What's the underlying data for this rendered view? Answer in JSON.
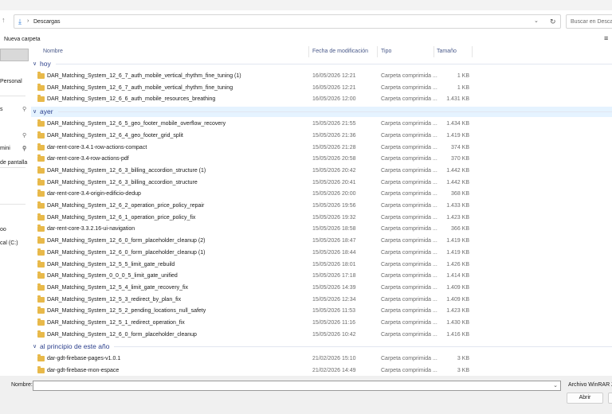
{
  "address": {
    "folder": "Descargas"
  },
  "search": {
    "placeholder": "Buscar en Descargas"
  },
  "toolbar": {
    "new_folder": "Nueva carpeta"
  },
  "sidebar": {
    "items": [
      {
        "label": "Personal",
        "pinned": false
      },
      {
        "label": "s",
        "pinned": true
      },
      {
        "label": "",
        "pinned": true
      },
      {
        "label": "",
        "pinned": true
      },
      {
        "label": "mini",
        "pinned": true
      },
      {
        "label": "de pantalla",
        "pinned": false
      },
      {
        "label": "",
        "pinned": false
      },
      {
        "label": "oo",
        "pinned": false
      },
      {
        "label": "cal (C:)",
        "pinned": false
      }
    ]
  },
  "columns": {
    "name": "Nombre",
    "date": "Fecha de modificación",
    "type": "Tipo",
    "size": "Tamaño"
  },
  "groups": [
    {
      "label": "hoy",
      "selected": false,
      "rows": [
        {
          "name": "DAR_Matching_System_12_6_7_auth_mobile_vertical_rhythm_fine_tuning (1)",
          "date": "16/05/2026 12:21",
          "type": "Carpeta comprimida ...",
          "size": "1 KB"
        },
        {
          "name": "DAR_Matching_System_12_6_7_auth_mobile_vertical_rhythm_fine_tuning",
          "date": "16/05/2026 12:21",
          "type": "Carpeta comprimida ...",
          "size": "1 KB"
        },
        {
          "name": "DAR_Matching_System_12_6_6_auth_mobile_resources_breathing",
          "date": "16/05/2026 12:00",
          "type": "Carpeta comprimida ...",
          "size": "1.431 KB"
        }
      ]
    },
    {
      "label": "ayer",
      "selected": true,
      "rows": [
        {
          "name": "DAR_Matching_System_12_6_5_geo_footer_mobile_overflow_recovery",
          "date": "15/05/2026 21:55",
          "type": "Carpeta comprimida ...",
          "size": "1.434 KB"
        },
        {
          "name": "DAR_Matching_System_12_6_4_geo_footer_grid_split",
          "date": "15/05/2026 21:36",
          "type": "Carpeta comprimida ...",
          "size": "1.419 KB"
        },
        {
          "name": "dar-rent-core-3.4.1-row-actions-compact",
          "date": "15/05/2026 21:28",
          "type": "Carpeta comprimida ...",
          "size": "374 KB"
        },
        {
          "name": "dar-rent-core-3.4-row-actions-pdf",
          "date": "15/05/2026 20:58",
          "type": "Carpeta comprimida ...",
          "size": "370 KB"
        },
        {
          "name": "DAR_Matching_System_12_6_3_billing_accordion_structure (1)",
          "date": "15/05/2026 20:42",
          "type": "Carpeta comprimida ...",
          "size": "1.442 KB"
        },
        {
          "name": "DAR_Matching_System_12_6_3_billing_accordion_structure",
          "date": "15/05/2026 20:41",
          "type": "Carpeta comprimida ...",
          "size": "1.442 KB"
        },
        {
          "name": "dar-rent-core-3.4-origin-edificio-dedup",
          "date": "15/05/2026 20:00",
          "type": "Carpeta comprimida ...",
          "size": "368 KB"
        },
        {
          "name": "DAR_Matching_System_12_6_2_operation_price_policy_repair",
          "date": "15/05/2026 19:56",
          "type": "Carpeta comprimida ...",
          "size": "1.433 KB"
        },
        {
          "name": "DAR_Matching_System_12_6_1_operation_price_policy_fix",
          "date": "15/05/2026 19:32",
          "type": "Carpeta comprimida ...",
          "size": "1.423 KB"
        },
        {
          "name": "dar-rent-core-3.3.2.16-ui-navigation",
          "date": "15/05/2026 18:58",
          "type": "Carpeta comprimida ...",
          "size": "366 KB"
        },
        {
          "name": "DAR_Matching_System_12_6_0_form_placeholder_cleanup (2)",
          "date": "15/05/2026 18:47",
          "type": "Carpeta comprimida ...",
          "size": "1.419 KB"
        },
        {
          "name": "DAR_Matching_System_12_6_0_form_placeholder_cleanup (1)",
          "date": "15/05/2026 18:44",
          "type": "Carpeta comprimida ...",
          "size": "1.419 KB"
        },
        {
          "name": "DAR_Matching_System_12_5_5_limit_gate_rebuild",
          "date": "15/05/2026 18:01",
          "type": "Carpeta comprimida ...",
          "size": "1.426 KB"
        },
        {
          "name": "DAR_Matching_System_0_0_0_5_limit_gate_unified",
          "date": "15/05/2026 17:18",
          "type": "Carpeta comprimida ...",
          "size": "1.414 KB"
        },
        {
          "name": "DAR_Matching_System_12_5_4_limit_gate_recovery_fix",
          "date": "15/05/2026 14:39",
          "type": "Carpeta comprimida ...",
          "size": "1.409 KB"
        },
        {
          "name": "DAR_Matching_System_12_5_3_redirect_by_plan_fix",
          "date": "15/05/2026 12:34",
          "type": "Carpeta comprimida ...",
          "size": "1.409 KB"
        },
        {
          "name": "DAR_Matching_System_12_5_2_pending_locations_null_safety",
          "date": "15/05/2026 11:53",
          "type": "Carpeta comprimida ...",
          "size": "1.423 KB"
        },
        {
          "name": "DAR_Matching_System_12_5_1_redirect_operation_fix",
          "date": "15/05/2026 11:16",
          "type": "Carpeta comprimida ...",
          "size": "1.430 KB"
        },
        {
          "name": "DAR_Matching_System_12_6_0_form_placeholder_cleanup",
          "date": "15/05/2026 10:42",
          "type": "Carpeta comprimida ...",
          "size": "1.416 KB"
        }
      ]
    },
    {
      "label": "al principio de este año",
      "selected": false,
      "rows": [
        {
          "name": "dar-gdt-firebase-pages-v1.0.1",
          "date": "21/02/2026 15:10",
          "type": "Carpeta comprimida ...",
          "size": "3 KB"
        },
        {
          "name": "dar-gdt-firebase-mon-espace",
          "date": "21/02/2026 14:49",
          "type": "Carpeta comprimida ...",
          "size": "3 KB"
        }
      ]
    }
  ],
  "footer": {
    "filename_label": "Nombre:",
    "filename_value": "",
    "filetype": "Archivo WinRAR ZIP",
    "open_label": "Abrir"
  }
}
